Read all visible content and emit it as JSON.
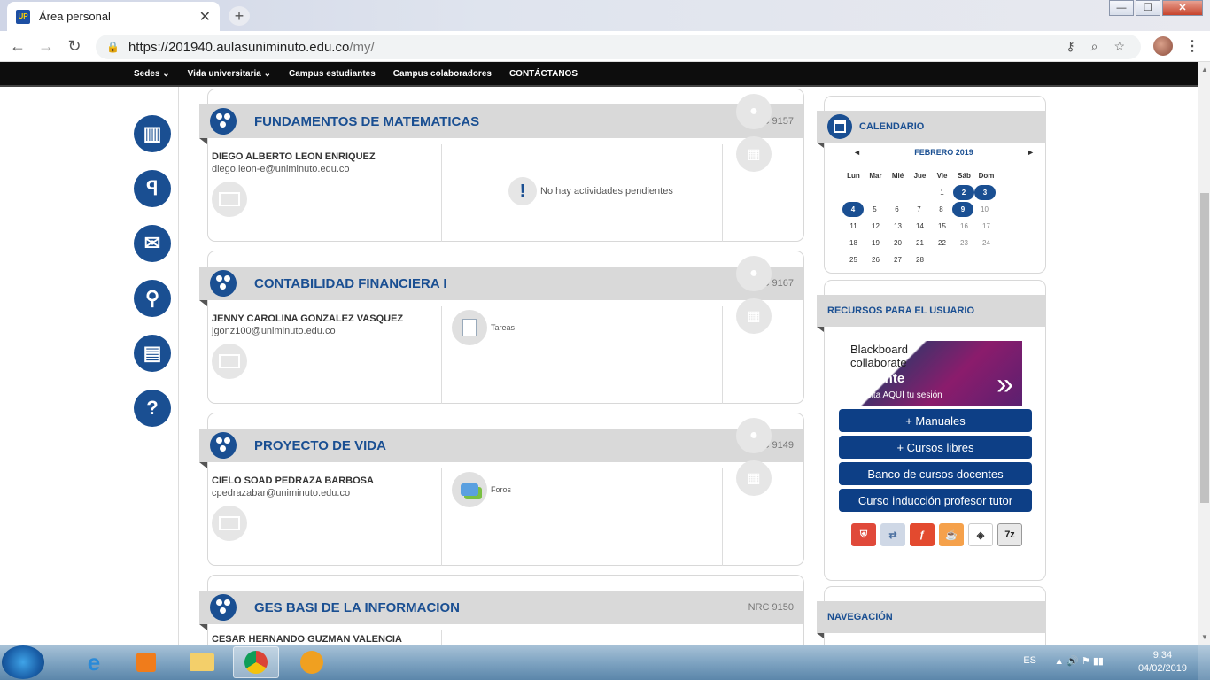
{
  "browser": {
    "tab_title": "Área personal",
    "url_host": "https://201940.aulasuniminuto.edu.co",
    "url_path": "/my/"
  },
  "site_nav": [
    "Sedes ⌄",
    "Vida universitaria ⌄",
    "Campus estudiantes",
    "Campus colaboradores",
    "CONTÁCTANOS"
  ],
  "courses": [
    {
      "title": "FUNDAMENTOS DE MATEMATICAS",
      "nrc": "NRC 9157",
      "teacher": "DIEGO ALBERTO LEON ENRIQUEZ",
      "email": "diego.leon-e@uniminuto.edu.co",
      "pending": "No hay actividades pendientes"
    },
    {
      "title": "CONTABILIDAD FINANCIERA I",
      "nrc": "NRC 9167",
      "teacher": "JENNY CAROLINA GONZALEZ VASQUEZ",
      "email": "jgonz100@uniminuto.edu.co",
      "activity": "Tareas"
    },
    {
      "title": "PROYECTO DE VIDA",
      "nrc": "NRC 9149",
      "teacher": "CIELO SOAD PEDRAZA BARBOSA",
      "email": "cpedrazabar@uniminuto.edu.co",
      "activity": "Foros"
    },
    {
      "title": "GES BASI DE LA INFORMACION",
      "nrc": "NRC 9150",
      "teacher": "CESAR HERNANDO GUZMAN VALENCIA"
    }
  ],
  "calendar": {
    "title": "CALENDARIO",
    "month": "FEBRERO 2019",
    "prev": "◄",
    "next": "►",
    "days": [
      "Lun",
      "Mar",
      "Mié",
      "Jue",
      "Vie",
      "Sáb",
      "Dom"
    ],
    "weeks": [
      [
        "",
        "",
        "",
        "",
        "1",
        "2",
        "3"
      ],
      [
        "4",
        "5",
        "6",
        "7",
        "8",
        "9",
        "10"
      ],
      [
        "11",
        "12",
        "13",
        "14",
        "15",
        "16",
        "17"
      ],
      [
        "18",
        "19",
        "20",
        "21",
        "22",
        "23",
        "24"
      ],
      [
        "25",
        "26",
        "27",
        "28",
        "",
        "",
        ""
      ]
    ],
    "event_days": [
      "2",
      "3",
      "4",
      "9"
    ]
  },
  "resources": {
    "title": "RECURSOS PARA EL USUARIO",
    "banner_brand_1": "Blackboard",
    "banner_brand_2": "collaborate",
    "banner_title": "Docente",
    "banner_sub": "Solicita AQUÍ tu sesión",
    "buttons": [
      "+ Manuales",
      "+ Cursos libres",
      "Banco de cursos docentes",
      "Curso inducción profesor tutor"
    ],
    "plugins": [
      "acrobat-icon",
      "translate-icon",
      "flash-icon",
      "java-icon",
      "unity-icon",
      "7zip-icon"
    ],
    "plugin_colors": [
      "#e0493a",
      "#cfd8e6",
      "#e34a2f",
      "#f5a14b",
      "#ffffff",
      "#e8e8e8"
    ]
  },
  "navigation": {
    "title": "NAVEGACIÓN"
  },
  "taskbar": {
    "lang": "ES",
    "time": "9:34",
    "date": "04/02/2019"
  },
  "colors": {
    "brand": "#1a4f92",
    "button": "#0d3f86"
  }
}
